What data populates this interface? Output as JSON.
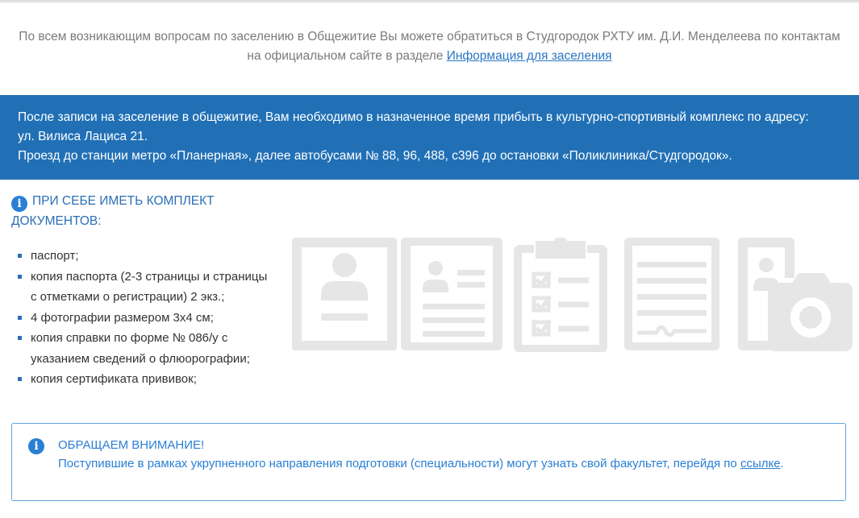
{
  "intro": {
    "line1": "По всем возникающим вопросам по заселению в Общежитие Вы можете обратиться в Студгородок РХТУ им. Д.И. Менделеева по контактам",
    "line2_prefix": "на официальном сайте в разделе ",
    "link_text": "Информация для заселения"
  },
  "banner": {
    "line1": "После записи на заселение в общежитие, Вам необходимо в назначенное время прибыть в культурно-спортивный комплекс по адресу:",
    "line2": "ул. Вилиса Лациса 21.",
    "line3": "Проезд до станции метро «Планерная», далее автобусами № 88, 96, 488, с396 до остановки «Поликлиника/Студгородок»."
  },
  "documents": {
    "icon": "info-icon",
    "heading_line1": "ПРИ СЕБЕ ИМЕТЬ КОМПЛЕКТ",
    "heading_line2": "ДОКУМЕНТОВ:",
    "items": [
      "паспорт;",
      "копия паспорта (2-3 страницы и страницы с отметками о регистрации) 2 экз.;",
      "4 фотографии размером 3х4 см;",
      "копия справки по форме № 086/у с указанием сведений о флюорографии;",
      "копия сертификата прививок;"
    ]
  },
  "illustrations": [
    "passport-icon",
    "id-card-icon",
    "checklist-icon",
    "signed-document-icon",
    "photo-camera-icon"
  ],
  "notice": {
    "icon": "info-icon",
    "title": "ОБРАЩАЕМ ВНИМАНИЕ!",
    "text": "Поступившие в рамках укрупненного направления подготовки (специальности) могут узнать свой факультет, перейдя по ",
    "link_text": "ссылке",
    "suffix": "."
  },
  "colors": {
    "banner_bg": "#2170b6",
    "accent": "#2a7fd4",
    "illustration_gray": "#e6e6e6"
  }
}
